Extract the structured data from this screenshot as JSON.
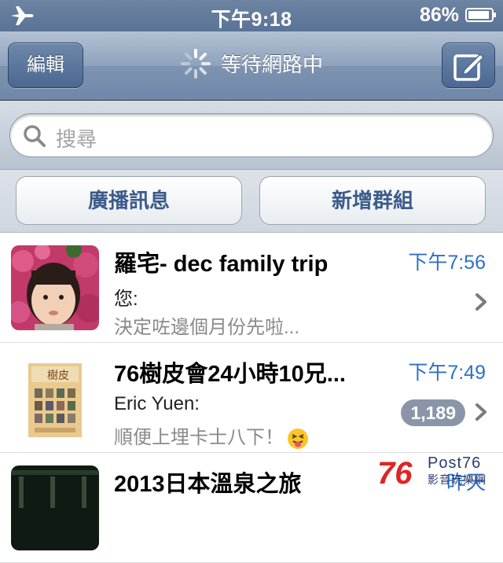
{
  "status": {
    "time": "下午9:18",
    "battery": "86%"
  },
  "nav": {
    "edit": "編輯",
    "title": "等待網路中"
  },
  "search": {
    "placeholder": "搜尋"
  },
  "actions": {
    "broadcast": "廣播訊息",
    "new_group": "新增群組"
  },
  "chats": [
    {
      "title": "羅宅- dec family trip",
      "time": "下午7:56",
      "sender": "您:",
      "preview": "決定咗邊個月份先啦..."
    },
    {
      "title": "76樹皮會24小時10兄...",
      "time": "下午7:49",
      "sender": "Eric Yuen:",
      "preview": "順便上埋卡士八下！",
      "badge": "1,189"
    },
    {
      "title": "2013日本溫泉之旅",
      "time": "昨天"
    }
  ],
  "watermark": {
    "num": "76",
    "post": "Post76",
    "sub": "影音玩樂網"
  },
  "colors": {
    "accent_blue": "#2f6fc9",
    "nav": "#6f87a8",
    "badge": "#8a96a8"
  }
}
